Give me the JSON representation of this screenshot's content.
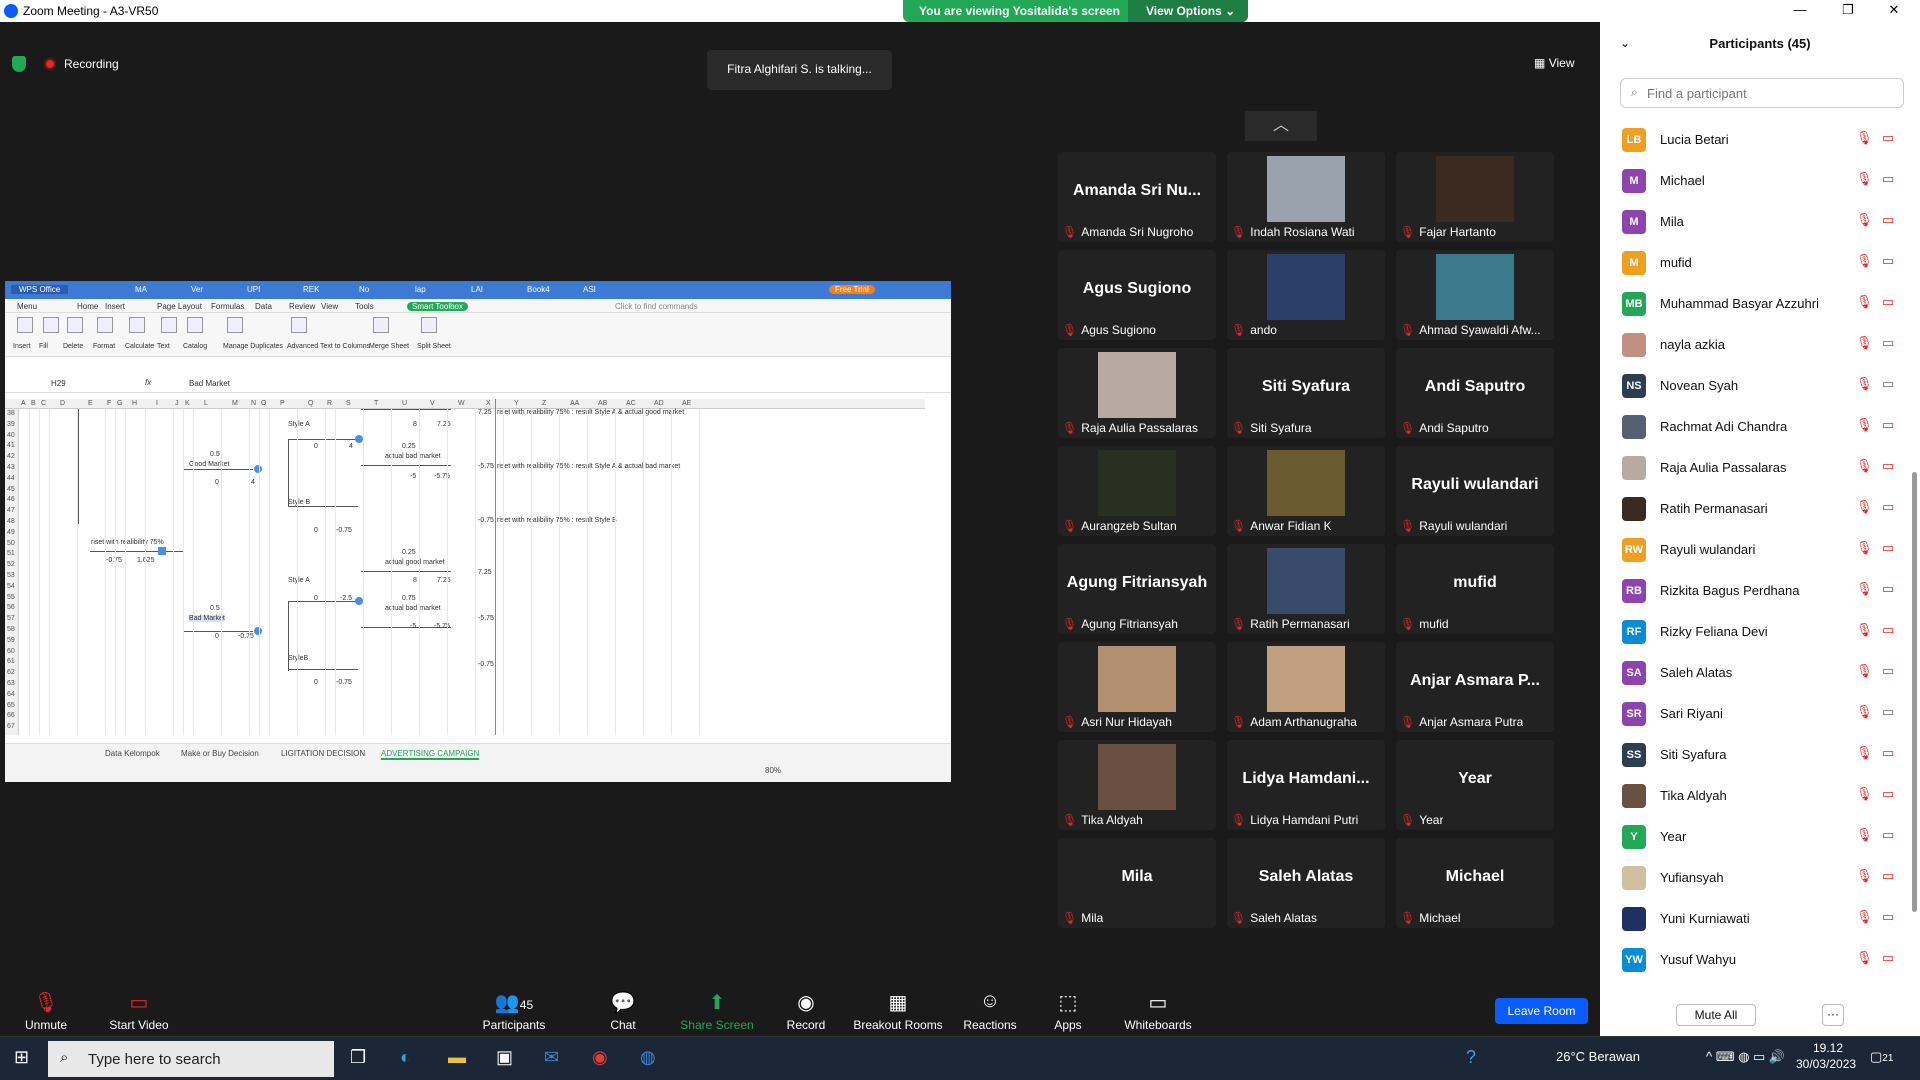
{
  "window": {
    "title": "Zoom Meeting - A3-VR50"
  },
  "banner": {
    "viewing": "You are viewing Yositalida's screen",
    "options": "View Options"
  },
  "meeting": {
    "recording": "Recording",
    "talking": "Fitra Alghifari S. is talking...",
    "view": "View"
  },
  "sheet": {
    "app": "WPS Office",
    "tabs": [
      "MA",
      "Ver",
      "UPI",
      "REK",
      "No",
      "lap",
      "LAI",
      "Book4",
      "ASI"
    ],
    "free_trial": "Free Trial",
    "menu": [
      "Menu",
      "Home",
      "Insert",
      "Page Layout",
      "Formulas",
      "Data",
      "Review",
      "View",
      "Tools",
      "Smart Toolbox"
    ],
    "find": "Click to find commands",
    "ribbon": [
      "Insert",
      "Fill",
      "Delete",
      "Format",
      "Calculate",
      "Text",
      "Catalog",
      "Manage Duplicates",
      "Advanced Text to Columns",
      "Merge Sheet",
      "Split Sheet"
    ],
    "cell_ref": "H29",
    "formula": "Bad Market",
    "columns": [
      "A",
      "B",
      "C",
      "D",
      "E",
      "F",
      "G",
      "H",
      "I",
      "J",
      "K",
      "L",
      "M",
      "N",
      "O",
      "P",
      "Q",
      "R",
      "S",
      "T",
      "U",
      "V",
      "W",
      "X",
      "Y",
      "Z",
      "AA",
      "AB",
      "AC",
      "AD",
      "AE"
    ],
    "rows": [
      "38",
      "39",
      "40",
      "41",
      "42",
      "43",
      "44",
      "45",
      "46",
      "47",
      "48",
      "49",
      "50",
      "51",
      "52",
      "53",
      "54",
      "55",
      "56",
      "57",
      "58",
      "59",
      "60",
      "61",
      "62",
      "63",
      "64",
      "65",
      "66",
      "67"
    ],
    "cells": {
      "style_a_top": "Style A",
      "v8a": "8",
      "v725a": "7.25",
      "r725": "7.25",
      "note1": "riset with realibility 75% : result Style A & actual good market",
      "v05": "0.5",
      "good_market": "Good Market",
      "v0a": "0",
      "v4a": "4",
      "v0b": "0",
      "v4b": "4",
      "v025": "0.25",
      "actual_bad": "actual bad market",
      "r575": "-5.75",
      "note2": "riset with realibility 75% : result Style A & actual bad market",
      "vm5": "-5",
      "vm575": "-5.75",
      "style_b": "Style B",
      "r075": "-0.75",
      "note3": "riset with realibility 75% : result Style B",
      "v0c": "0",
      "vm075": "-0.75",
      "riset": "riset with realibility 75%",
      "vm075b": "-0.75",
      "v1625": "1.625",
      "v025b": "0.25",
      "actual_good2": "actual good market",
      "r725b": "7.25",
      "style_a_2": "Style A",
      "v8b": "8",
      "v725b": "7.25",
      "v0d": "0",
      "vm25": "-2.5",
      "v075": "0.75",
      "actual_bad2": "actual bad market",
      "v05b": "0.5",
      "bad_market": "Bad Market",
      "vm5b": "-5",
      "vm575b": "-5.75",
      "r575b": "-5.75",
      "v0e": "0",
      "vm075c": "-0.75",
      "styleb2": "StyleB",
      "r075b": "-0.75",
      "v0f": "0",
      "vm075d": "-0.75"
    },
    "sheet_tabs": [
      "Data Kelompok",
      "Make or Buy Decision",
      "LIGITATION DECISION",
      "ADVERTISING CAMPAIGN"
    ],
    "zoom": "80%"
  },
  "gallery": [
    {
      "big": "Amanda Sri Nu...",
      "label": "Amanda Sri Nugroho",
      "photo": false
    },
    {
      "big": "",
      "label": "Indah Rosiana Wati",
      "photo": true,
      "color": "#9aa3ad"
    },
    {
      "big": "",
      "label": "Fajar Hartanto",
      "photo": true,
      "color": "#3b2a20"
    },
    {
      "big": "Agus Sugiono",
      "label": "Agus Sugiono",
      "photo": false
    },
    {
      "big": "",
      "label": "ando",
      "photo": true,
      "color": "#2b3f6a"
    },
    {
      "big": "",
      "label": "Ahmad Syawaldi Afw...",
      "photo": true,
      "color": "#3a7a8a"
    },
    {
      "big": "",
      "label": "Raja Aulia Passalaras",
      "photo": true,
      "color": "#b8aaa0"
    },
    {
      "big": "Siti Syafura",
      "label": "Siti Syafura",
      "photo": false
    },
    {
      "big": "Andi Saputro",
      "label": "Andi Saputro",
      "photo": false
    },
    {
      "big": "",
      "label": "Aurangzeb Sultan",
      "photo": true,
      "color": "#2a3020"
    },
    {
      "big": "",
      "label": "Anwar Fidian K",
      "photo": true,
      "color": "#6a5a30"
    },
    {
      "big": "Rayuli wulandari",
      "label": "Rayuli wulandari",
      "photo": false
    },
    {
      "big": "Agung Fitriansyah",
      "label": "Agung Fitriansyah",
      "photo": false
    },
    {
      "big": "",
      "label": "Ratih Permanasari",
      "photo": true,
      "color": "#3a4a6a"
    },
    {
      "big": "mufid",
      "label": "mufid",
      "photo": false
    },
    {
      "big": "",
      "label": "Asri Nur Hidayah",
      "photo": true,
      "color": "#b09070"
    },
    {
      "big": "",
      "label": "Adam Arthanugraha",
      "photo": true,
      "color": "#c0a080"
    },
    {
      "big": "Anjar Asmara P...",
      "label": "Anjar Asmara Putra",
      "photo": false
    },
    {
      "big": "",
      "label": "Tika Aldyah",
      "photo": true,
      "color": "#6a5040"
    },
    {
      "big": "Lidya  Hamdani...",
      "label": "Lidya Hamdani Putri",
      "photo": false
    },
    {
      "big": "Year",
      "label": "Year",
      "photo": false
    },
    {
      "big": "Mila",
      "label": "Mila",
      "photo": false
    },
    {
      "big": "Saleh Alatas",
      "label": "Saleh Alatas",
      "photo": false
    },
    {
      "big": "Michael",
      "label": "Michael",
      "photo": false
    }
  ],
  "participants": {
    "title": "Participants (45)",
    "search_placeholder": "Find a participant",
    "list": [
      {
        "initials": "LB",
        "name": "Lucia Betari",
        "color": "#f0a020",
        "cam_on": false
      },
      {
        "initials": "M",
        "name": "Michael",
        "color": "#8e44ad",
        "cam_on": false
      },
      {
        "initials": "M",
        "name": "Mila",
        "color": "#8e44ad",
        "cam_on": false
      },
      {
        "initials": "M",
        "name": "mufid",
        "color": "#f0a020",
        "cam_on": false
      },
      {
        "initials": "MB",
        "name": "Muhammad Basyar Azzuhri",
        "color": "#23a857",
        "cam_on": false
      },
      {
        "initials": "",
        "name": "nayla azkia",
        "color": "#c09080",
        "cam_on": false
      },
      {
        "initials": "NS",
        "name": "Novean Syah",
        "color": "#2c3e50",
        "cam_on": true
      },
      {
        "initials": "",
        "name": "Rachmat Adi Chandra",
        "color": "#556070",
        "cam_on": false
      },
      {
        "initials": "",
        "name": "Raja Aulia Passalaras",
        "color": "#b8aaa0",
        "cam_on": false
      },
      {
        "initials": "",
        "name": "Ratih Permanasari",
        "color": "#3a2a20",
        "cam_on": false
      },
      {
        "initials": "RW",
        "name": "Rayuli wulandari",
        "color": "#f0a020",
        "cam_on": false
      },
      {
        "initials": "RB",
        "name": "Rizkita Bagus Perdhana",
        "color": "#8e44ad",
        "cam_on": false
      },
      {
        "initials": "RF",
        "name": "Rizky Feliana Devi",
        "color": "#0b8cd6",
        "cam_on": false
      },
      {
        "initials": "SA",
        "name": "Saleh Alatas",
        "color": "#8e44ad",
        "cam_on": false
      },
      {
        "initials": "SR",
        "name": "Sari Riyani",
        "color": "#8e44ad",
        "cam_on": true
      },
      {
        "initials": "SS",
        "name": "Siti Syafura",
        "color": "#2c3e50",
        "cam_on": false
      },
      {
        "initials": "",
        "name": "Tika Aldyah",
        "color": "#6a5040",
        "cam_on": false
      },
      {
        "initials": "Y",
        "name": "Year",
        "color": "#23a857",
        "cam_on": false
      },
      {
        "initials": "",
        "name": "Yufiansyah",
        "color": "#d0c0a0",
        "cam_on": false
      },
      {
        "initials": "",
        "name": "Yuni Kurniawati",
        "color": "#203060",
        "cam_on": false
      },
      {
        "initials": "YW",
        "name": "Yusuf Wahyu",
        "color": "#0b8cd6",
        "cam_on": false
      }
    ],
    "mute_all": "Mute All",
    "more": "···"
  },
  "toolbar": {
    "unmute": "Unmute",
    "start_video": "Start Video",
    "participants": "Participants",
    "participants_count": "45",
    "chat": "Chat",
    "share": "Share Screen",
    "record": "Record",
    "breakout": "Breakout Rooms",
    "reactions": "Reactions",
    "apps": "Apps",
    "whiteboards": "Whiteboards",
    "leave": "Leave Room"
  },
  "taskbar": {
    "search_placeholder": "Type here to search",
    "weather": "26°C  Berawan",
    "time": "19.12",
    "date": "30/03/2023",
    "notif_count": "21"
  }
}
